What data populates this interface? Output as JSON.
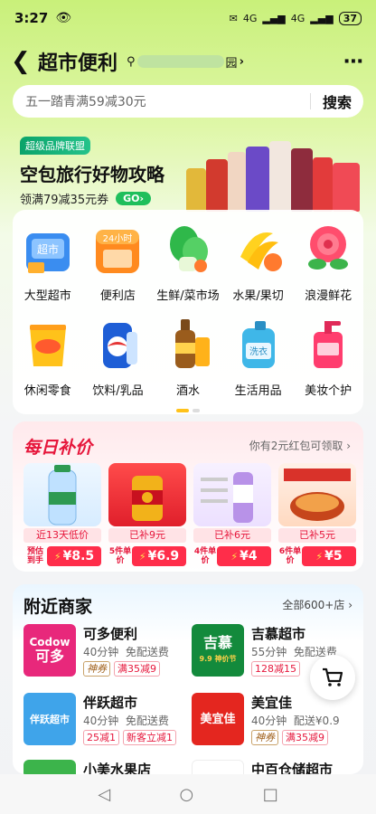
{
  "status_bar": {
    "time": "3:27",
    "network_1": "4G",
    "network_2": "4G",
    "battery": "37"
  },
  "header": {
    "title": "超市便利",
    "location_suffix": "园"
  },
  "search": {
    "placeholder": "五一踏青满59减30元",
    "button": "搜索"
  },
  "promo": {
    "tag": "超级品牌联盟",
    "headline": "空包旅行好物攻略",
    "subline": "领满79减35元券",
    "go": "GO"
  },
  "categories": [
    {
      "label": "大型超市",
      "icon": "supermarket-basket-icon"
    },
    {
      "label": "便利店",
      "icon": "24h-store-icon"
    },
    {
      "label": "生鲜/菜市场",
      "icon": "vegetables-icon"
    },
    {
      "label": "水果/果切",
      "icon": "banana-icon"
    },
    {
      "label": "浪漫鲜花",
      "icon": "rose-icon"
    },
    {
      "label": "休闲零食",
      "icon": "chips-icon"
    },
    {
      "label": "饮料/乳品",
      "icon": "soda-can-icon"
    },
    {
      "label": "酒水",
      "icon": "beer-icon"
    },
    {
      "label": "生活用品",
      "icon": "detergent-icon"
    },
    {
      "label": "美妆个护",
      "icon": "lotion-pump-icon"
    }
  ],
  "deals": {
    "title": "每日补价",
    "note": "你有2元红包可领取",
    "items": [
      {
        "caption": "近13天低价",
        "price_label": "预估到手",
        "price": "8.5"
      },
      {
        "caption": "已补9元",
        "price_label": "5件单价",
        "price": "6.9"
      },
      {
        "caption": "已补6元",
        "price_label": "4件单价",
        "price": "4"
      },
      {
        "caption": "已补5元",
        "price_label": "6件单价",
        "price": "5"
      }
    ]
  },
  "nearby": {
    "title": "附近商家",
    "all_link": "全部600+店",
    "stores": [
      {
        "name": "可多便利",
        "logo_text": "可多",
        "logo_sub": "Codow",
        "time": "40分钟",
        "delivery": "免配送费",
        "coupons": [
          {
            "text": "神券",
            "style": "dark"
          },
          {
            "text": "满35减9",
            "style": "red"
          }
        ]
      },
      {
        "name": "吉慕超市",
        "logo_text": "吉慕",
        "logo_sub": "9.9 神价节",
        "time": "55分钟",
        "delivery": "免配送费",
        "coupons": [
          {
            "text": "128减15",
            "style": "red"
          }
        ]
      },
      {
        "name": "伴跃超市",
        "logo_text": "伴跃超市",
        "logo_sub": "",
        "time": "40分钟",
        "delivery": "免配送费",
        "coupons": [
          {
            "text": "25减1",
            "style": "red"
          },
          {
            "text": "新客立减1",
            "style": "red"
          }
        ]
      },
      {
        "name": "美宜佳",
        "logo_text": "美宜佳",
        "logo_sub": "",
        "time": "40分钟",
        "delivery": "配送¥0.9",
        "coupons": [
          {
            "text": "神券",
            "style": "dark"
          },
          {
            "text": "满35减9",
            "style": "red"
          }
        ]
      },
      {
        "name": "小美水果店",
        "logo_text": "",
        "logo_sub": "",
        "time": "",
        "delivery": "",
        "coupons": []
      },
      {
        "name": "中百仓储超市",
        "logo_text": "",
        "logo_sub": "",
        "time": "",
        "delivery": "",
        "coupons": []
      }
    ]
  },
  "colors": {
    "accent_red": "#e6163b",
    "accent_green": "#1fbf5c"
  }
}
